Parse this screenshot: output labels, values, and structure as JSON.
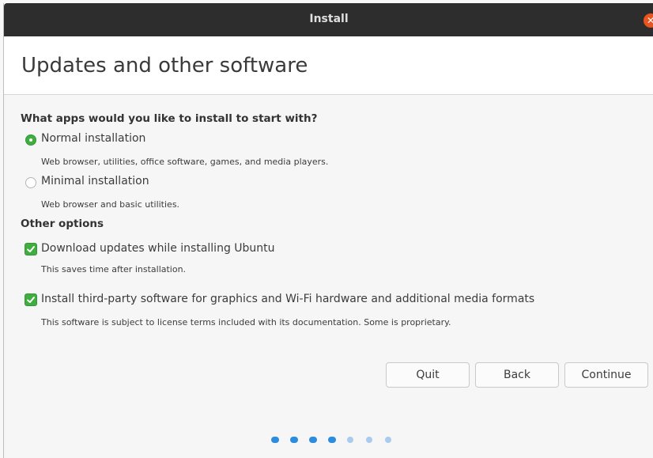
{
  "window": {
    "title": "Install",
    "close_glyph": "✕"
  },
  "header": {
    "title": "Updates and other software"
  },
  "apps_section": {
    "heading": "What apps would you like to install to start with?",
    "options": [
      {
        "label": "Normal installation",
        "description": "Web browser, utilities, office software, games, and media players.",
        "selected": true
      },
      {
        "label": "Minimal installation",
        "description": "Web browser and basic utilities.",
        "selected": false
      }
    ]
  },
  "other_section": {
    "heading": "Other options",
    "options": [
      {
        "label": "Download updates while installing Ubuntu",
        "description": "This saves time after installation.",
        "checked": true
      },
      {
        "label": "Install third-party software for graphics and Wi-Fi hardware and additional media formats",
        "description": "This software is subject to license terms included with its documentation. Some is proprietary.",
        "checked": true
      }
    ]
  },
  "buttons": {
    "quit": "Quit",
    "back": "Back",
    "continue": "Continue"
  },
  "progress": {
    "current_step": 4,
    "total_steps": 7
  },
  "colors": {
    "accent_green": "#3fae3f",
    "progress_done": "#2c8de0",
    "progress_todo": "#a8cbee",
    "close_orange": "#e95420",
    "titlebar": "#2d2d2d"
  }
}
